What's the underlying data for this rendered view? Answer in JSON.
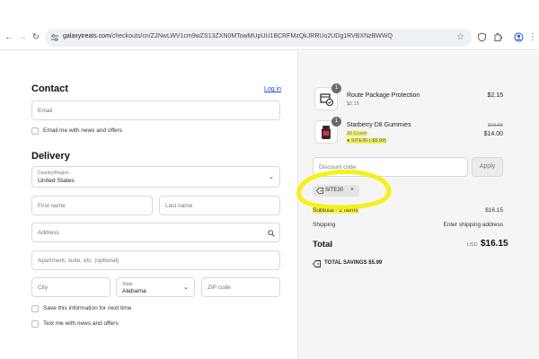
{
  "browser": {
    "url_host": "galaxytreats.com",
    "url_path": "/checkouts/cn/Z2NwLWV1cm9wZS13ZXN0MTowMUpUU1BCRFMzQkJRRUo2UDg1RVBXNzBWWQ",
    "icons": [
      "back-icon",
      "forward-icon",
      "reload-icon",
      "site-info-icon",
      "star-icon",
      "shield-extension-icon",
      "extensions-icon",
      "profile-icon",
      "menu-icon"
    ]
  },
  "contact": {
    "title": "Contact",
    "login_link": "Log in",
    "email_placeholder": "Email",
    "email_news_label": "Email me with news and offers"
  },
  "delivery": {
    "title": "Delivery",
    "country_label": "Country/Region",
    "country_value": "United States",
    "first_name_placeholder": "First name",
    "last_name_placeholder": "Last name",
    "address_placeholder": "Address",
    "apartment_placeholder": "Apartment, suite, etc. (optional)",
    "city_placeholder": "City",
    "state_label": "State",
    "state_value": "Alabama",
    "zip_placeholder": "ZIP code",
    "save_info_label": "Save this information for next time",
    "text_news_label": "Text me with news and offers"
  },
  "order": {
    "items": [
      {
        "qty": "1",
        "title": "Route Package Protection",
        "subtitle": "$2.15",
        "price": "$2.15"
      },
      {
        "qty": "1",
        "title": "Starberry D8 Gummies",
        "subtitle": "20 Count",
        "discount": "SITE30 (-$5.99)",
        "original_price": "$19.99",
        "price": "$14.00"
      }
    ],
    "discount_placeholder": "Discount code",
    "apply_label": "Apply",
    "applied_code": "SITE30",
    "subtotal_label": "Subtotal · 2 items",
    "subtotal_value": "$16.15",
    "shipping_label": "Shipping",
    "shipping_value": "Enter shipping address",
    "total_label": "Total",
    "currency": "USD",
    "total_value": "$16.15",
    "savings_label": "TOTAL SAVINGS",
    "savings_value": "$5.99"
  },
  "colors": {
    "highlighter": "#f5f000",
    "link": "#1a4fcf",
    "summary_bg": "#f5f5f5"
  }
}
